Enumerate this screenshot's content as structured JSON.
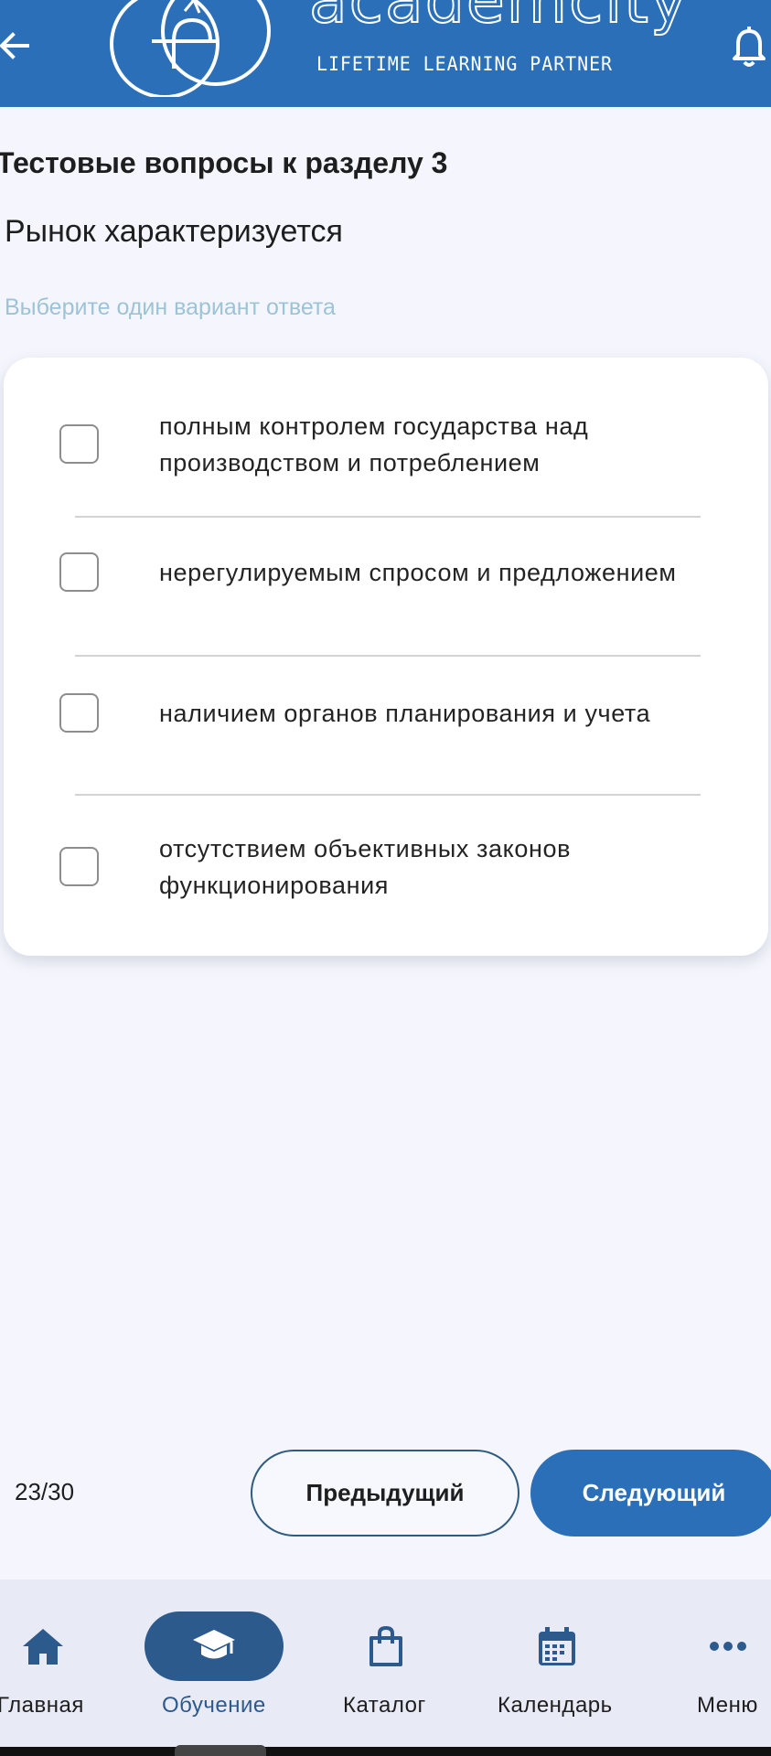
{
  "header": {
    "brand_name": "academcity",
    "tagline": "LIFETIME LEARNING PARTNER",
    "back_icon": "arrow-left-icon",
    "notifications_icon": "bell-icon",
    "background_color": "#2a6fb8"
  },
  "quiz": {
    "section_title": "Тестовые вопросы к разделу 3",
    "question": "Рынок характеризуется",
    "instruction": "Выберите один вариант ответа",
    "options": [
      {
        "label": "полным контролем государства над производством и потреблением",
        "checked": false
      },
      {
        "label": "нерегулируемым спросом и предложением",
        "checked": false
      },
      {
        "label": "наличием органов планирования и учета",
        "checked": false
      },
      {
        "label": "отсутствием объективных законов функционирования",
        "checked": false
      }
    ]
  },
  "pager": {
    "counter": "23/30",
    "prev_label": "Предыдущий",
    "next_label": "Следующий",
    "accent_color": "#2a6fb8"
  },
  "bottom_nav": {
    "items": [
      {
        "label": "Главная",
        "icon": "home-icon",
        "active": false
      },
      {
        "label": "Обучение",
        "icon": "graduation-cap-icon",
        "active": true
      },
      {
        "label": "Каталог",
        "icon": "shopping-bag-icon",
        "active": false
      },
      {
        "label": "Календарь",
        "icon": "calendar-icon",
        "active": false
      },
      {
        "label": "Меню",
        "icon": "more-horizontal-icon",
        "active": false
      }
    ],
    "active_color": "#2d5a8c"
  }
}
